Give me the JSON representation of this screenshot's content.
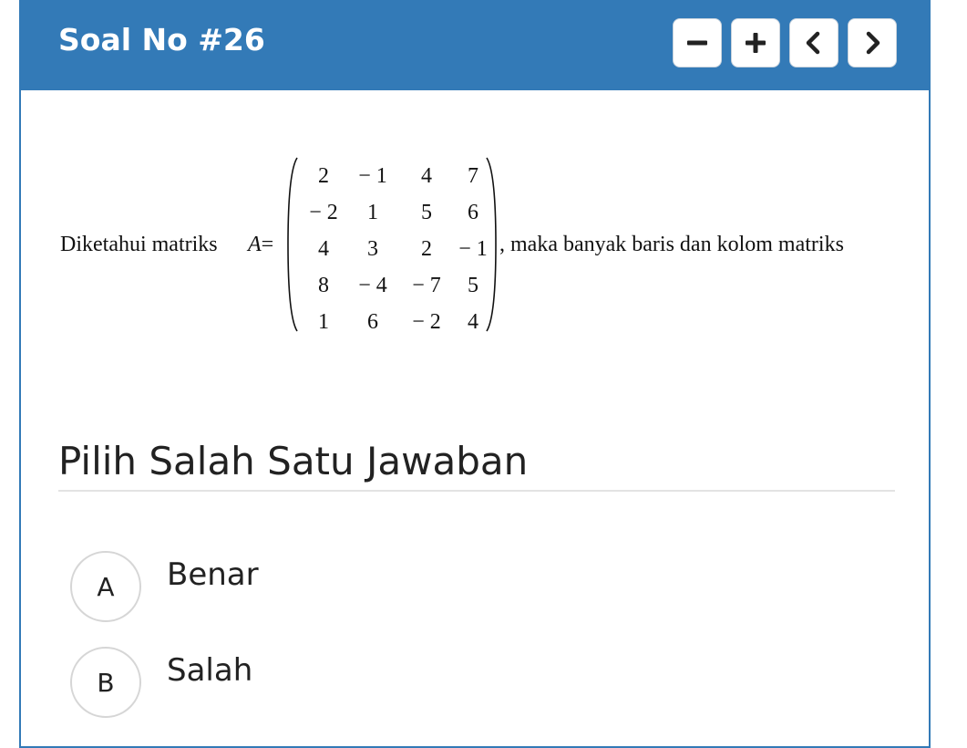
{
  "header": {
    "title": "Soal No #26",
    "controls": [
      {
        "name": "zoom-out",
        "icon": "minus-icon"
      },
      {
        "name": "zoom-in",
        "icon": "plus-icon"
      },
      {
        "name": "previous",
        "icon": "chevron-left-icon"
      },
      {
        "name": "next",
        "icon": "chevron-right-icon"
      }
    ],
    "color": "#337ab7"
  },
  "question": {
    "text_before": "Diketahui matriks",
    "variable": "A",
    "equals": "=",
    "matrix": [
      [
        "2",
        "− 1",
        "4",
        "7"
      ],
      [
        "− 2",
        "1",
        "5",
        "6"
      ],
      [
        "4",
        "3",
        "2",
        "− 1"
      ],
      [
        "8",
        "− 4",
        "− 7",
        "5"
      ],
      [
        "1",
        "6",
        "− 2",
        "4"
      ]
    ],
    "text_after": ", maka banyak baris dan kolom matriks"
  },
  "answers": {
    "heading": "Pilih Salah Satu Jawaban",
    "options": [
      {
        "letter": "A",
        "label": "Benar"
      },
      {
        "letter": "B",
        "label": "Salah"
      }
    ]
  }
}
